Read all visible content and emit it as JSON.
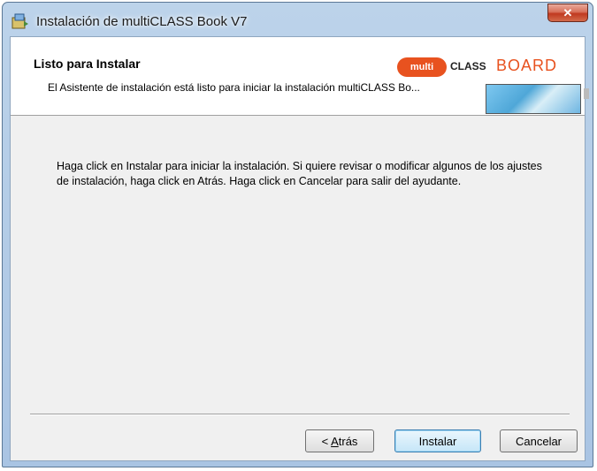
{
  "window": {
    "title": "Instalación de multiCLASS Book V7",
    "close_label": "✕"
  },
  "banner": {
    "heading": "Listo para Instalar",
    "description": "El Asistente de instalación está listo para iniciar la instalación multiCLASS Bo...",
    "logo": {
      "multi": "multi",
      "class": "CLASS",
      "board": "BOARD"
    }
  },
  "body": {
    "text": "Haga click en Instalar para iniciar la instalación. Si quiere revisar o modificar algunos de los ajustes de instalación, haga click en Atrás. Haga click en Cancelar para salir del ayudante."
  },
  "buttons": {
    "back_prefix": "< ",
    "back_mnemonic": "A",
    "back_rest": "trás",
    "install": "Instalar",
    "cancel": "Cancelar"
  },
  "colors": {
    "brand_orange": "#e8521f",
    "close_red": "#c0391f"
  }
}
